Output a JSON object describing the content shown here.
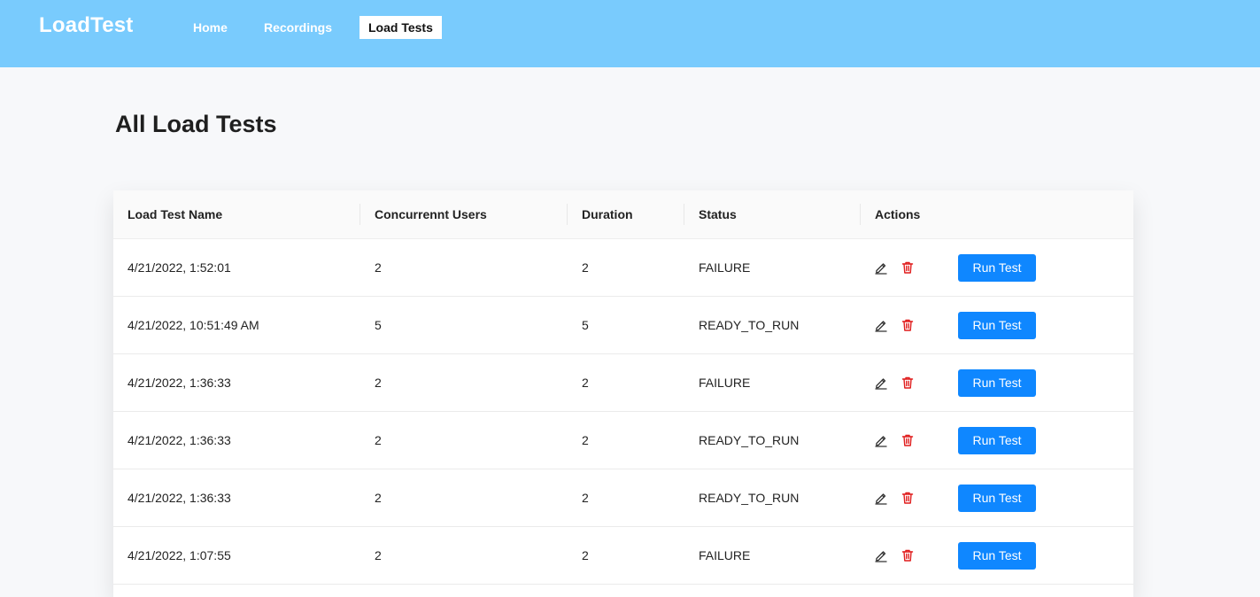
{
  "navbar": {
    "brand": "LoadTest",
    "links": [
      {
        "label": "Home",
        "active": false
      },
      {
        "label": "Recordings",
        "active": false
      },
      {
        "label": "Load Tests",
        "active": true
      }
    ],
    "background": "#79cbfd"
  },
  "page": {
    "title": "All Load Tests"
  },
  "table": {
    "columns": [
      "Load Test Name",
      "Concurrennt Users",
      "Duration",
      "Status",
      "Actions"
    ],
    "rows": [
      {
        "name": "4/21/2022, 1:52:01",
        "users": "2",
        "duration": "2",
        "status": "FAILURE",
        "action_label": "Run Test"
      },
      {
        "name": "4/21/2022, 10:51:49 AM",
        "users": "5",
        "duration": "5",
        "status": "READY_TO_RUN",
        "action_label": "Run Test"
      },
      {
        "name": "4/21/2022, 1:36:33",
        "users": "2",
        "duration": "2",
        "status": "FAILURE",
        "action_label": "Run Test"
      },
      {
        "name": "4/21/2022, 1:36:33",
        "users": "2",
        "duration": "2",
        "status": "READY_TO_RUN",
        "action_label": "Run Test"
      },
      {
        "name": "4/21/2022, 1:36:33",
        "users": "2",
        "duration": "2",
        "status": "READY_TO_RUN",
        "action_label": "Run Test"
      },
      {
        "name": "4/21/2022, 1:07:55",
        "users": "2",
        "duration": "2",
        "status": "FAILURE",
        "action_label": "Run Test"
      }
    ],
    "row_icons": [
      "edit-icon",
      "delete-icon"
    ],
    "colors": {
      "run_button": "#0f87ff",
      "delete_icon": "#e01c1c"
    }
  }
}
